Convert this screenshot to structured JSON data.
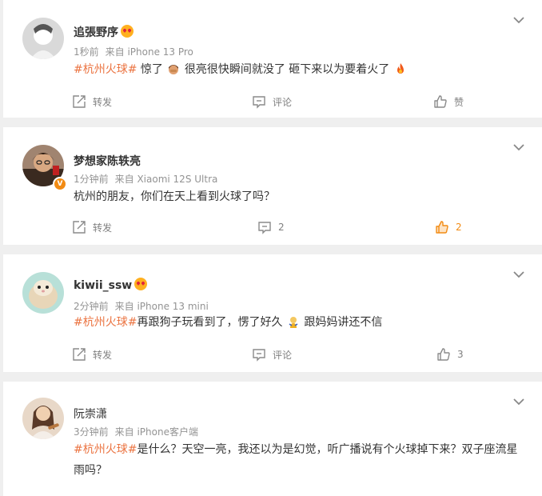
{
  "comments": [
    {
      "user": "追張野序",
      "time": "1秒前",
      "source": "来自 iPhone 13 Pro",
      "tag": "#杭州火球#",
      "text_parts": [
        "惊了",
        "很亮很快瞬间就没了 砸下来以为要着火了"
      ],
      "repost_label": "转发",
      "comment_label": "评论",
      "like_label": "赞",
      "liked": false
    },
    {
      "user": "梦想家陈轶亮",
      "time": "1分钟前",
      "source": "来自 Xiaomi 12S Ultra",
      "text": "杭州的朋友，你们在天上看到火球了吗？",
      "verified_badge": "V",
      "repost_label": "转发",
      "comment_count": "2",
      "like_count": "2",
      "liked": true
    },
    {
      "user": "kiwii_ssw",
      "time": "2分钟前",
      "source": "来自 iPhone 13 mini",
      "tag": "#杭州火球#",
      "text_parts": [
        "再跟狗子玩看到了，愣了好久",
        "跟妈妈讲还不信"
      ],
      "repost_label": "转发",
      "comment_label": "评论",
      "like_count": "3",
      "liked": false
    },
    {
      "user": "阮崇潇",
      "time": "3分钟前",
      "source": "来自 iPhone客户端",
      "tag": "#杭州火球#",
      "text": "是什么？天空一亮，我还以为是幻觉，听广播说有个火球掉下来？双子座流星雨吗？"
    }
  ],
  "colors": {
    "tag": "#eb7340",
    "accent_like": "#f28b13",
    "meta_text": "#939393",
    "background": "#efefef"
  },
  "icons": {
    "repost": "repost-icon",
    "comment": "comment-icon",
    "like": "thumbs-up-icon",
    "more": "chevron-down-icon"
  }
}
